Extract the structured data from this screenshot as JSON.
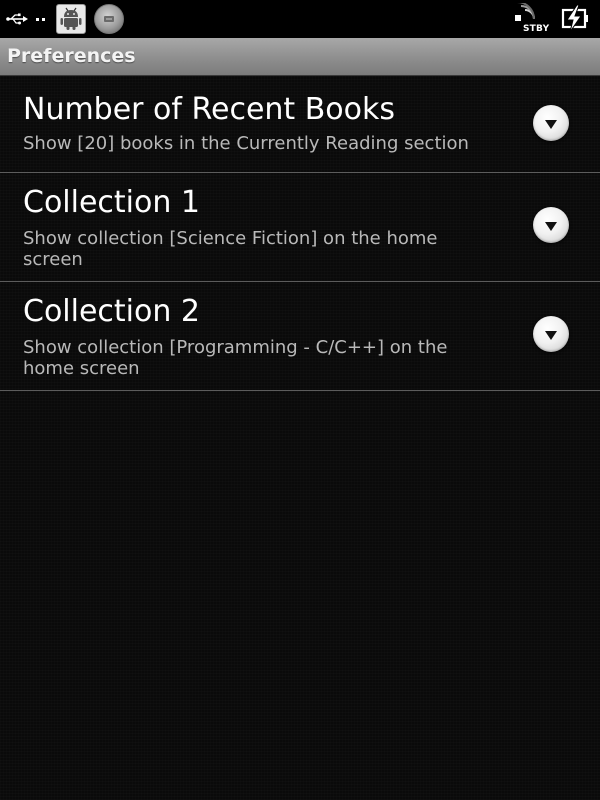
{
  "status_bar": {
    "icons": [
      "usb-icon",
      "android-debug-icon",
      "disc-icon",
      "signal-standby-icon",
      "battery-charging-icon"
    ],
    "standby_label": "STBY"
  },
  "title_bar": {
    "title": "Preferences"
  },
  "preferences": [
    {
      "title": "Number of Recent Books",
      "summary": "Show [20] books in the Currently Reading section",
      "control_icon": "dropdown-arrow-icon"
    },
    {
      "title": "Collection 1",
      "summary": "Show collection [Science Fiction] on the home screen",
      "control_icon": "dropdown-arrow-icon"
    },
    {
      "title": "Collection 2",
      "summary": "Show collection [Programming - C/C++] on the home screen",
      "control_icon": "dropdown-arrow-icon"
    }
  ],
  "colors": {
    "background": "#0a0a0a",
    "title_bar": "#8e8e8e",
    "divider": "#5c5c5c",
    "summary_text": "#b9b9b9"
  }
}
